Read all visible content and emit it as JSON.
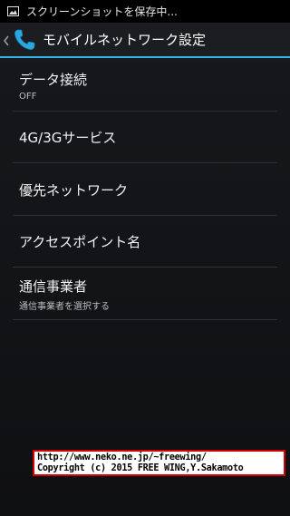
{
  "status_bar": {
    "icon": "image-icon",
    "text": "スクリーンショットを保存中..."
  },
  "action_bar": {
    "icon": "phone-icon",
    "title": "モバイルネットワーク設定",
    "accent_color": "#33b5e5"
  },
  "settings": {
    "items": [
      {
        "title": "データ接続",
        "summary": "OFF"
      },
      {
        "title": "4G/3Gサービス"
      },
      {
        "title": "優先ネットワーク"
      },
      {
        "title": "アクセスポイント名"
      },
      {
        "title": "通信事業者",
        "summary": "通信事業者を選択する"
      }
    ]
  },
  "watermark": {
    "line1": "http://www.neko.ne.jp/~freewing/",
    "line2": "Copyright (c) 2015 FREE WING,Y.Sakamoto",
    "border_color": "#d20000"
  }
}
